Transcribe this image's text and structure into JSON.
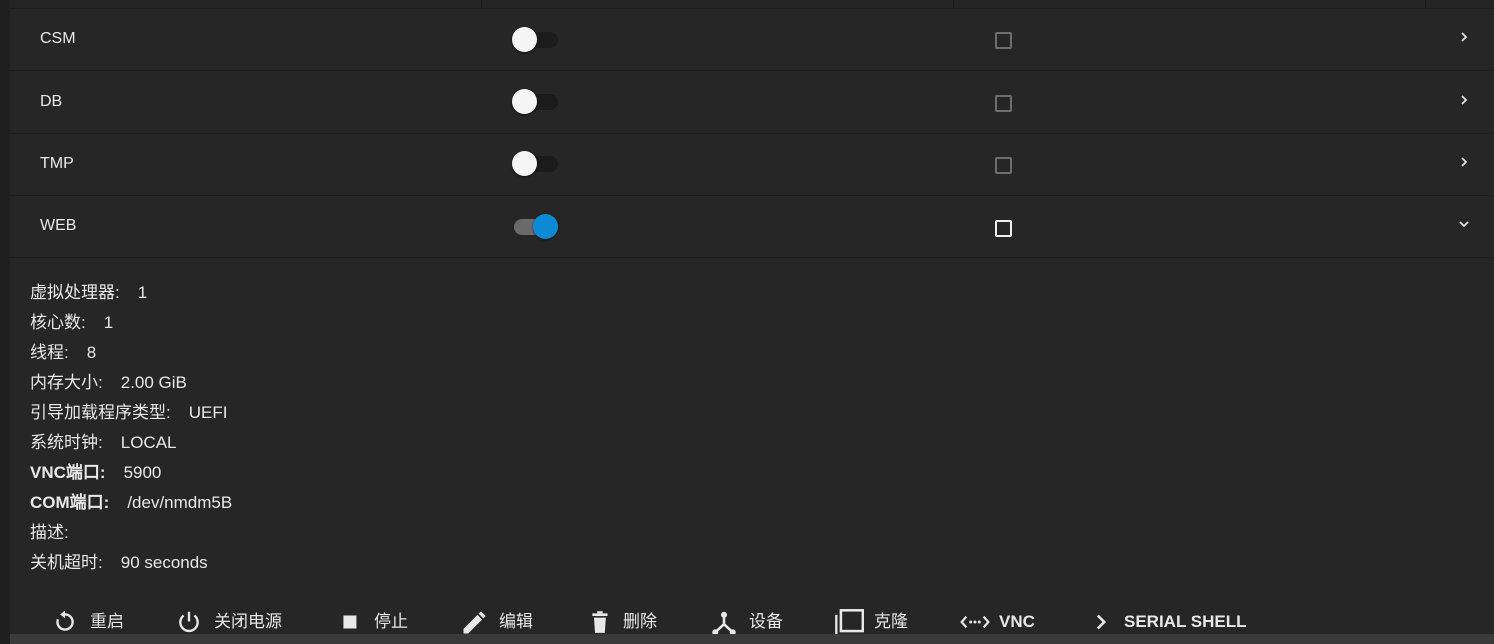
{
  "vm_rows": [
    {
      "name": "CSM",
      "autostart": false,
      "selected": false,
      "expanded": false
    },
    {
      "name": "DB",
      "autostart": false,
      "selected": false,
      "expanded": false
    },
    {
      "name": "TMP",
      "autostart": false,
      "selected": false,
      "expanded": false
    },
    {
      "name": "WEB",
      "autostart": true,
      "selected": false,
      "expanded": true
    }
  ],
  "details": [
    {
      "label": "虚拟处理器:",
      "value": "1"
    },
    {
      "label": "核心数:",
      "value": "1"
    },
    {
      "label": "线程:",
      "value": "8"
    },
    {
      "label": "内存大小:",
      "value": "2.00 GiB"
    },
    {
      "label": "引导加载程序类型:",
      "value": "UEFI"
    },
    {
      "label": "系统时钟:",
      "value": "LOCAL"
    },
    {
      "label": "VNC端口:",
      "value": "5900"
    },
    {
      "label": "COM端口:",
      "value": "/dev/nmdm5B"
    },
    {
      "label": "描述:",
      "value": ""
    },
    {
      "label": "关机超时:",
      "value": "90 seconds"
    }
  ],
  "actions": [
    {
      "label": "重启",
      "icon": "restart-icon"
    },
    {
      "label": "关闭电源",
      "icon": "power-icon"
    },
    {
      "label": "停止",
      "icon": "stop-icon"
    },
    {
      "label": "编辑",
      "icon": "pencil-icon"
    },
    {
      "label": "删除",
      "icon": "trash-icon"
    },
    {
      "label": "设备",
      "icon": "devices-icon"
    },
    {
      "label": "克隆",
      "icon": "clone-icon"
    },
    {
      "label": "VNC",
      "icon": "vnc-icon"
    },
    {
      "label": "SERIAL SHELL",
      "icon": "chevron-right-icon"
    }
  ],
  "colors": {
    "accent": "#0d8ad6",
    "background": "#262626",
    "text": "#e8e8e8"
  }
}
